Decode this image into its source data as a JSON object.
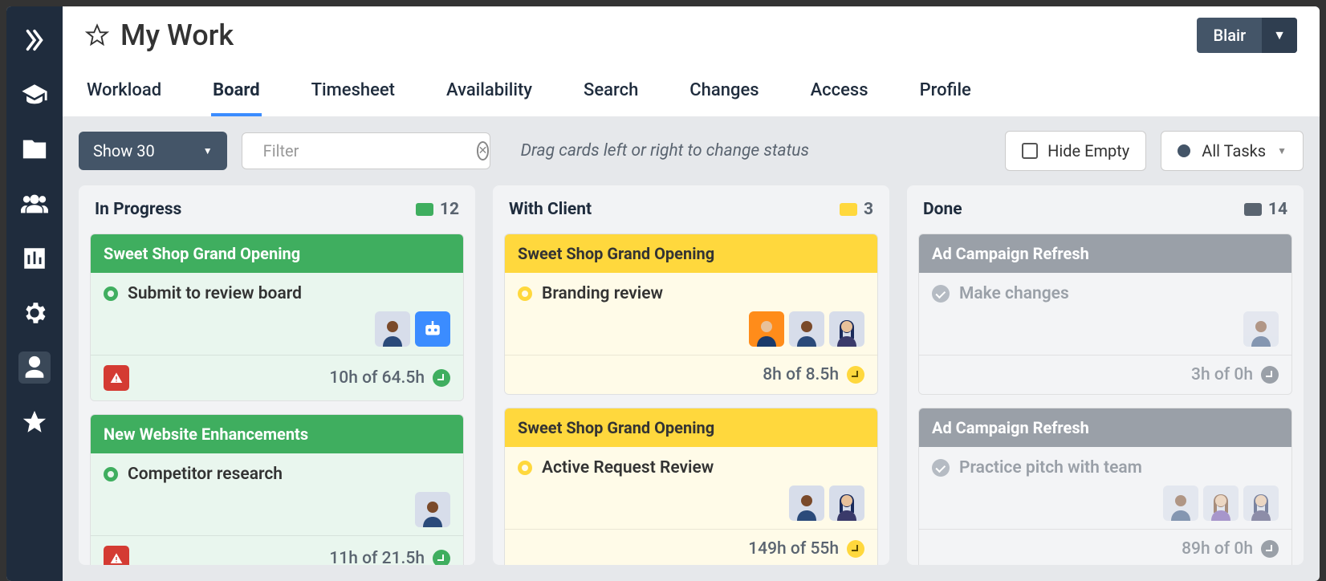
{
  "page_title": "My Work",
  "user_dropdown": "Blair",
  "tabs": [
    "Workload",
    "Board",
    "Timesheet",
    "Availability",
    "Search",
    "Changes",
    "Access",
    "Profile"
  ],
  "active_tab": 1,
  "show_dropdown": "Show 30",
  "filter_placeholder": "Filter",
  "hint": "Drag cards left or right to change status",
  "hide_empty_label": "Hide Empty",
  "all_tasks_label": "All Tasks",
  "columns": [
    {
      "title": "In Progress",
      "count": "12",
      "badge_color": "#3fae5f",
      "style": "green",
      "cards": [
        {
          "project": "Sweet Shop Grand Opening",
          "task": "Submit to review board",
          "avatars": [
            "person-dark",
            "bot"
          ],
          "hours": "10h of 64.5h",
          "warn": true
        },
        {
          "project": "New Website Enhancements",
          "task": "Competitor research",
          "avatars": [
            "person-dark"
          ],
          "hours": "11h of 21.5h",
          "warn": true
        }
      ]
    },
    {
      "title": "With Client",
      "count": "3",
      "badge_color": "#ffd83d",
      "style": "yellow",
      "cards": [
        {
          "project": "Sweet Shop Grand Opening",
          "task": "Branding review",
          "avatars": [
            "person-orange",
            "person-dark",
            "person-woman"
          ],
          "hours": "8h of 8.5h",
          "warn": false
        },
        {
          "project": "Sweet Shop Grand Opening",
          "task": "Active Request Review",
          "avatars": [
            "person-dark",
            "person-woman"
          ],
          "hours": "149h of 55h",
          "warn": false
        }
      ]
    },
    {
      "title": "Done",
      "count": "14",
      "badge_color": "#5a6470",
      "style": "gray",
      "cards": [
        {
          "project": "Ad Campaign Refresh",
          "task": "Make changes",
          "avatars": [
            "person-dark"
          ],
          "hours": "3h of 0h",
          "warn": false,
          "done": true
        },
        {
          "project": "Ad Campaign Refresh",
          "task": "Practice pitch with team",
          "avatars": [
            "person-dark",
            "person-woman2",
            "person-woman"
          ],
          "hours": "89h of 0h",
          "warn": false,
          "done": true
        }
      ]
    }
  ]
}
